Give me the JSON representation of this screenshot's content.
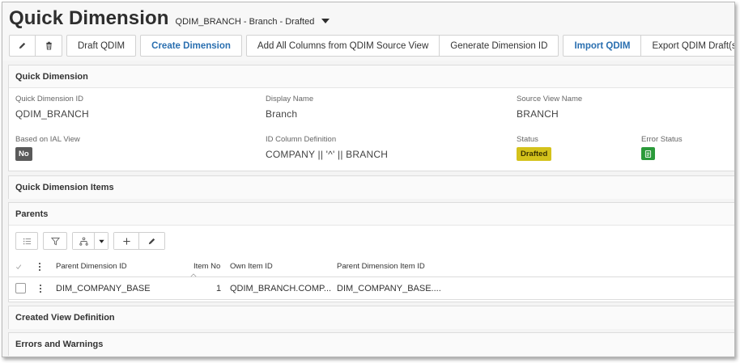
{
  "header": {
    "title": "Quick Dimension",
    "subtitle": "QDIM_BRANCH - Branch - Drafted"
  },
  "toolbar": {
    "edit_icon": "pencil-icon",
    "delete_icon": "trash-icon",
    "draft_qdim": "Draft QDIM",
    "create_dimension": "Create Dimension",
    "add_all_columns": "Add All Columns from QDIM Source View",
    "generate_dimension_id": "Generate Dimension ID",
    "import_qdim": "Import QDIM",
    "export_qdim_drafts": "Export QDIM Draft(s)",
    "accent_color": "#2a6fb0"
  },
  "quick_dimension": {
    "heading": "Quick Dimension",
    "fields": {
      "qdim_id_label": "Quick Dimension ID",
      "qdim_id_value": "QDIM_BRANCH",
      "display_name_label": "Display Name",
      "display_name_value": "Branch",
      "source_view_label": "Source View Name",
      "source_view_value": "BRANCH",
      "based_on_ial_label": "Based on IAL View",
      "based_on_ial_value": "No",
      "id_column_label": "ID Column Definition",
      "id_column_value": "COMPANY || '^' || BRANCH",
      "status_label": "Status",
      "status_value": "Drafted",
      "status_color": "#d4c21b",
      "error_status_label": "Error Status",
      "error_status_icon": "document-icon",
      "error_status_color": "#2b9a3a"
    }
  },
  "quick_dimension_items": {
    "heading": "Quick Dimension Items"
  },
  "parents": {
    "heading": "Parents",
    "columns": {
      "parent_dimension_id": "Parent Dimension ID",
      "item_no": "Item No",
      "own_item_id": "Own Item ID",
      "parent_dimension_item_id": "Parent Dimension Item ID"
    },
    "rows": [
      {
        "parent_dimension_id": "DIM_COMPANY_BASE",
        "item_no": "1",
        "own_item_id": "QDIM_BRANCH.COMP...",
        "parent_dimension_item_id": "DIM_COMPANY_BASE...."
      }
    ]
  },
  "created_view_definition": {
    "heading": "Created View Definition"
  },
  "errors_and_warnings": {
    "heading": "Errors and Warnings"
  }
}
